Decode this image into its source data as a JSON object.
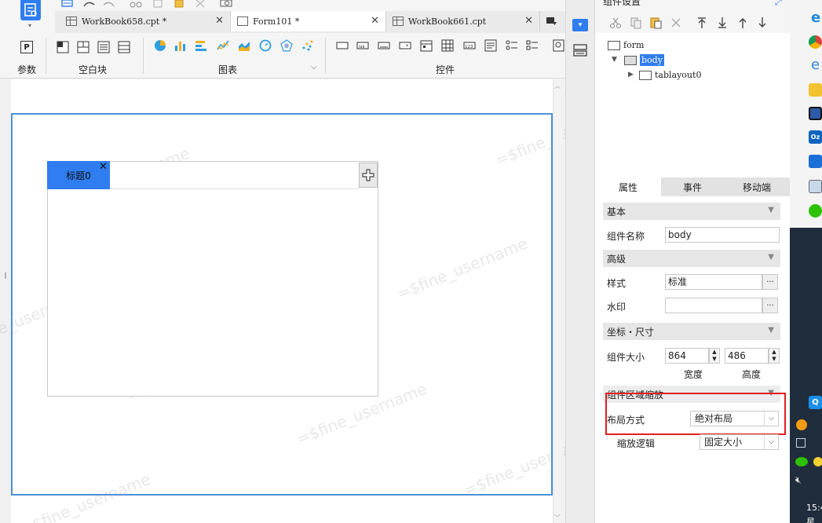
{
  "tabs": [
    {
      "label": "WorkBook658.cpt *",
      "active": false
    },
    {
      "label": "Form101 *",
      "active": true
    },
    {
      "label": "WorkBook661.cpt",
      "active": false
    }
  ],
  "toolbar_groups": {
    "params": "参数",
    "blank_block": "空白块",
    "chart": "图表",
    "controls": "控件"
  },
  "canvas": {
    "tab_title": "标题0",
    "watermark": "=$fine_username"
  },
  "right_panel": {
    "title": "组件设置",
    "tree": {
      "root": "form",
      "body": "body",
      "child": "tablayout0"
    },
    "prop_tabs": [
      "属性",
      "事件",
      "移动端"
    ],
    "sections": {
      "basic": "基本",
      "advanced": "高级",
      "coords": "坐标・尺寸",
      "scale": "组件区域缩放"
    },
    "fields": {
      "name_label": "组件名称",
      "name_value": "body",
      "style_label": "样式",
      "style_value": "标准",
      "watermark_label": "水印",
      "watermark_value": "",
      "size_label": "组件大小",
      "width_value": "864",
      "height_value": "486",
      "width_caption": "宽度",
      "height_caption": "高度",
      "layout_label": "布局方式",
      "layout_value": "绝对布局",
      "scale_logic_label": "缩放逻辑",
      "scale_logic_value": "固定大小"
    }
  },
  "taskbar": {
    "clock": "15:4",
    "day": "星期"
  },
  "colors": {
    "accent": "#2f7df0",
    "frame": "#4a90d9",
    "highlight": "#e02020"
  }
}
